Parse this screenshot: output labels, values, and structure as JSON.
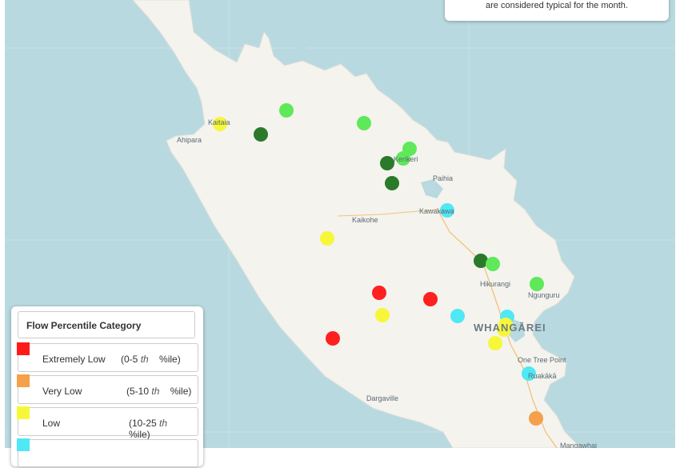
{
  "info_text": "are considered typical for the month.",
  "places": [
    {
      "name": "Kaitaia",
      "city": false
    },
    {
      "name": "Ahipara",
      "city": false
    },
    {
      "name": "Kerikeri",
      "city": false
    },
    {
      "name": "Paihia",
      "city": false
    },
    {
      "name": "Kaikohe",
      "city": false
    },
    {
      "name": "Kawakawa",
      "city": false
    },
    {
      "name": "Hikurangi",
      "city": false
    },
    {
      "name": "Ngunguru",
      "city": false
    },
    {
      "name": "WHANGĀREI",
      "city": true
    },
    {
      "name": "One Tree Point",
      "city": false
    },
    {
      "name": "Ruakākā",
      "city": false
    },
    {
      "name": "Dargaville",
      "city": false
    },
    {
      "name": "Mangawhai",
      "city": false
    }
  ],
  "legend": {
    "title": "Flow Percentile Category",
    "items": [
      {
        "label": "Extremely Low",
        "range_start": "(0-5",
        "range_th": "th",
        "range_end": "%ile)",
        "color": "#ff1a1a"
      },
      {
        "label": "Very Low",
        "range_start": "(5-10",
        "range_th": "th",
        "range_end": "%ile)",
        "color": "#f5a04a"
      },
      {
        "label": "Low",
        "range_start": "(10-25",
        "range_th": "th",
        "range_end": "%ile)",
        "color": "#f7f73a"
      },
      {
        "label": "",
        "range_start": "",
        "range_th": "",
        "range_end": "",
        "color": "#4fe8f5"
      }
    ]
  },
  "category_colors": {
    "extremely_low": "#ff2020",
    "very_low": "#f5a04a",
    "low": "#f7f73a",
    "below_normal": "#4fe8f5",
    "normal": "#5fe85a",
    "above_normal": "#2a7a2a"
  },
  "stations": [
    {
      "category": "low"
    },
    {
      "category": "normal"
    },
    {
      "category": "above_normal"
    },
    {
      "category": "normal"
    },
    {
      "category": "normal"
    },
    {
      "category": "normal"
    },
    {
      "category": "above_normal"
    },
    {
      "category": "above_normal"
    },
    {
      "category": "below_normal"
    },
    {
      "category": "low"
    },
    {
      "category": "above_normal"
    },
    {
      "category": "normal"
    },
    {
      "category": "normal"
    },
    {
      "category": "extremely_low"
    },
    {
      "category": "extremely_low"
    },
    {
      "category": "low"
    },
    {
      "category": "below_normal"
    },
    {
      "category": "below_normal"
    },
    {
      "category": "low"
    },
    {
      "category": "low"
    },
    {
      "category": "low"
    },
    {
      "category": "extremely_low"
    },
    {
      "category": "below_normal"
    },
    {
      "category": "very_low"
    }
  ]
}
